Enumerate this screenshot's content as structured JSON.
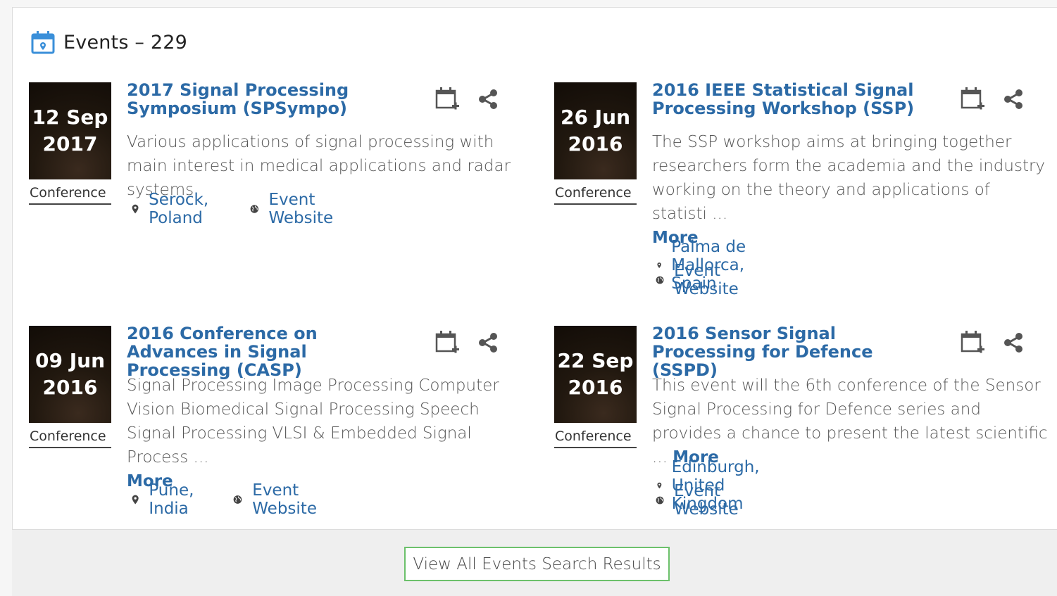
{
  "header": {
    "title": "Events – 229"
  },
  "events": [
    {
      "day": "12 Sep",
      "year": "2017",
      "type": "Conference",
      "title": "2017 Signal Processing Symposium (SPSympo)",
      "description": "Various applications of signal processing with main interest in medical applications and radar systems.",
      "more": "",
      "location": "Serock, Poland",
      "website": "Event Website"
    },
    {
      "day": "26 Jun",
      "year": "2016",
      "type": "Conference",
      "title": "2016 IEEE Statistical Signal Processing Workshop (SSP)",
      "description": "The SSP workshop aims at bringing together researchers form the academia and the industry working on the theory and applications of statisti ...",
      "more": "More",
      "location": "Palma de Mallorca, Spain",
      "website": "Event Website"
    },
    {
      "day": "09 Jun",
      "year": "2016",
      "type": "Conference",
      "title": "2016 Conference on Advances in Signal Processing (CASP)",
      "description": "Signal Processing Image Processing Computer Vision Biomedical Signal Processing Speech Signal Processing VLSI & Embedded Signal Process ...",
      "more": "More",
      "location": "Pune, India",
      "website": "Event Website"
    },
    {
      "day": "22 Sep",
      "year": "2016",
      "type": "Conference",
      "title": "2016 Sensor Signal Processing for Defence (SSPD)",
      "description": "This event will the 6th conference of the Sensor Signal Processing for Defence series and provides a chance to present the latest scientific ...",
      "more": "More",
      "location": "Edinburgh, United Kingdom",
      "website": "Event Website"
    }
  ],
  "footer": {
    "view_all_label": "View All Events Search Results"
  },
  "colors": {
    "link": "#2c6aa6",
    "button_border": "#6cc16b",
    "icon_blue": "#3a8fd9"
  },
  "icons": {
    "header": "calendar-icon",
    "add_calendar": "calendar-add-icon",
    "share": "share-icon",
    "location": "map-pin-icon",
    "website": "globe-icon"
  }
}
